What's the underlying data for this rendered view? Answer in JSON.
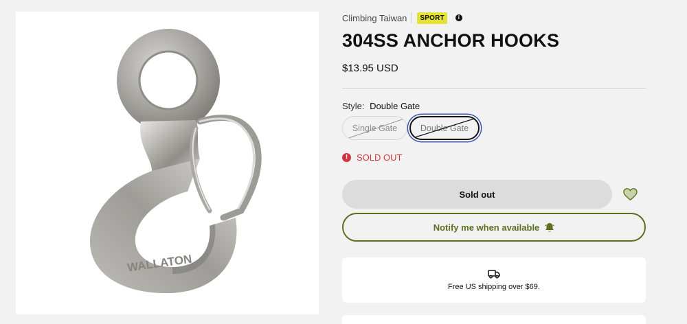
{
  "product": {
    "vendor": "Climbing Taiwan",
    "badge": "SPORT",
    "badge_color": "#e4e235",
    "title": "304SS ANCHOR HOOKS",
    "price": "$13.95 USD",
    "image_text": "WALLATON"
  },
  "variant_picker": {
    "label": "Style:",
    "selected": "Double Gate",
    "options": [
      {
        "label": "Single Gate",
        "available": false,
        "selected": false
      },
      {
        "label": "Double Gate",
        "available": false,
        "selected": true
      }
    ]
  },
  "stock": {
    "status": "SOLD OUT",
    "status_color": "#d0363e"
  },
  "actions": {
    "sold_out_label": "Sold out",
    "notify_label": "Notify me when available",
    "accent_color": "#5b6f1f",
    "wishlist_icon": "heart-icon",
    "notify_icon": "bell-icon"
  },
  "shipping": {
    "icon": "truck-icon",
    "text": "Free US shipping over $69."
  }
}
